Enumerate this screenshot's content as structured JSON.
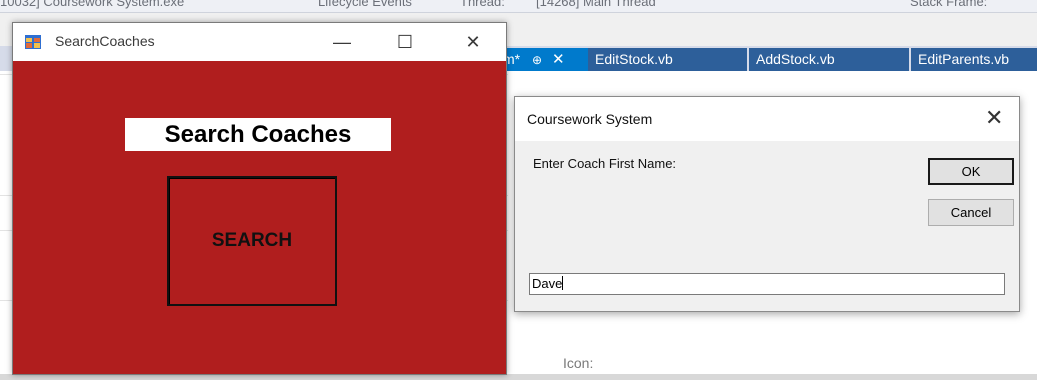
{
  "ide": {
    "top_items": [
      "10032] Coursework System.exe",
      "Lifecycle Events",
      "Thread:",
      "[14268] Main Thread",
      "Stack Frame:"
    ],
    "tabs": [
      {
        "label": "m*",
        "pin": "⊕",
        "close": "✕",
        "active": true
      },
      {
        "label": "EditStock.vb",
        "active": false
      },
      {
        "label": "AddStock.vb",
        "active": false
      },
      {
        "label": "EditParents.vb",
        "active": false
      }
    ],
    "icon_label": "Icon:"
  },
  "search_window": {
    "title": "SearchCoaches",
    "minimize": "—",
    "maximize": "☐",
    "close": "✕",
    "heading": "Search Coaches",
    "search_button": "SEARCH",
    "colors": {
      "background": "#b01e1e"
    }
  },
  "dialog": {
    "title": "Coursework System",
    "close": "✕",
    "prompt": "Enter Coach First Name:",
    "ok": "OK",
    "cancel": "Cancel",
    "input_value": "Dave"
  }
}
